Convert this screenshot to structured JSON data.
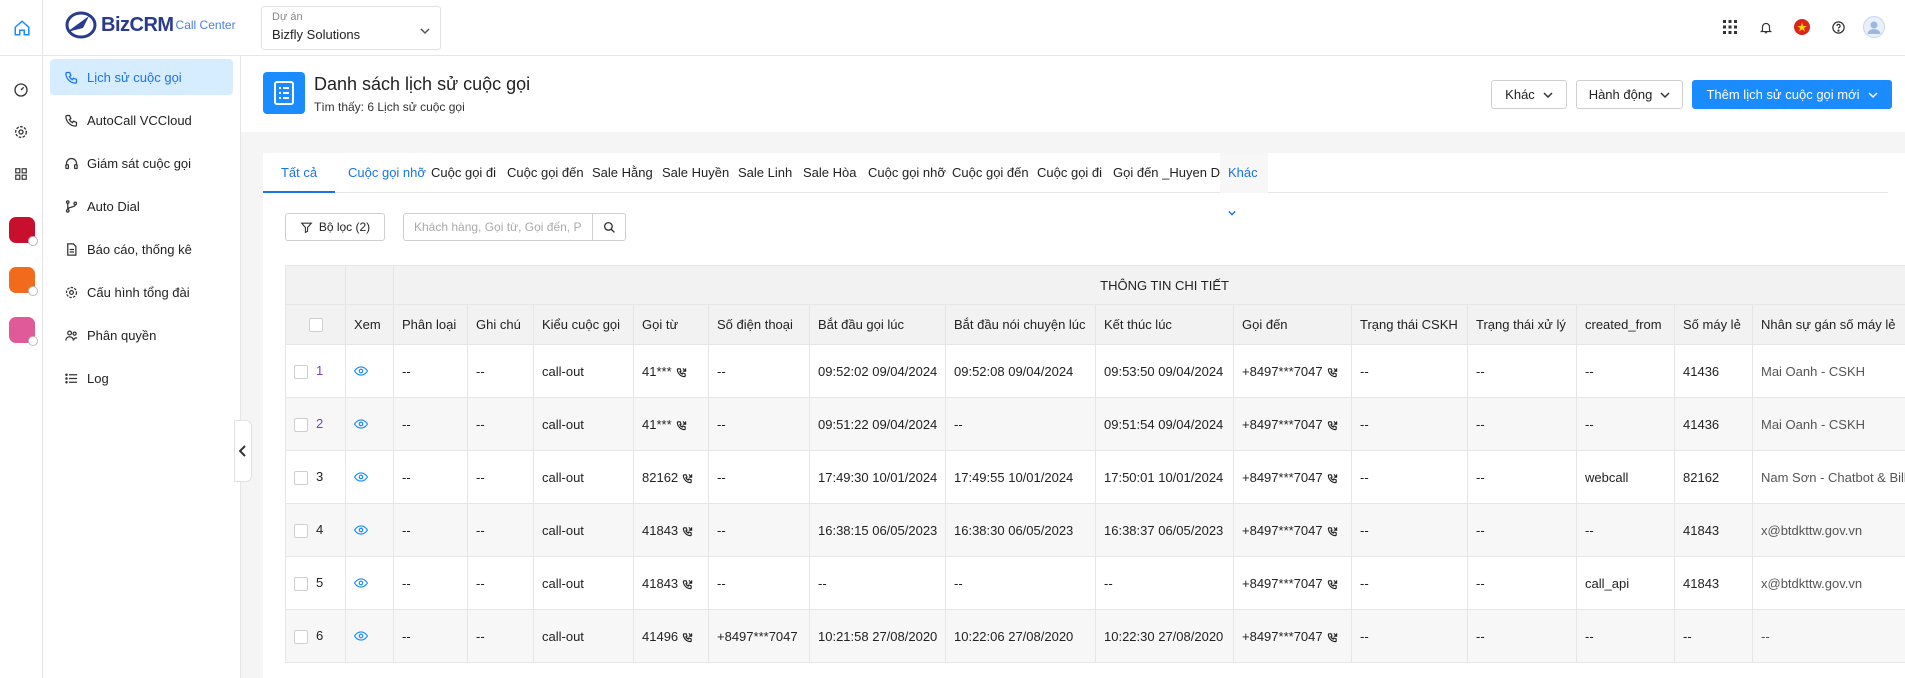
{
  "header": {
    "brand": "Biz",
    "brand_bold": "CRM",
    "brand_sub": "Call Center",
    "project_label": "Dự án",
    "project_value": "Bizfly Solutions"
  },
  "sidebar": {
    "items": [
      {
        "label": "Lịch sử cuộc gọi",
        "icon": "phone-history-icon"
      },
      {
        "label": "AutoCall VCCloud",
        "icon": "autocall-icon"
      },
      {
        "label": "Giám sát cuộc gọi",
        "icon": "headset-icon"
      },
      {
        "label": "Auto Dial",
        "icon": "branch-icon"
      },
      {
        "label": "Báo cáo, thống kê",
        "icon": "report-icon"
      },
      {
        "label": "Cấu hình tổng đài",
        "icon": "gear-icon"
      },
      {
        "label": "Phân quyền",
        "icon": "users-icon"
      },
      {
        "label": "Log",
        "icon": "list-icon"
      }
    ]
  },
  "page": {
    "title": "Danh sách lịch sử cuộc gọi",
    "subtitle": "Tìm thấy: 6 Lịch sử cuộc gọi",
    "btn_other": "Khác",
    "btn_action": "Hành động",
    "btn_add": "Thêm lịch sử cuộc gọi mới"
  },
  "tabs": [
    "Tất cả",
    "Cuộc gọi nhỡ",
    "Cuộc gọi đi",
    "Cuộc gọi đến",
    "Sale Hằng",
    "Sale Huyền",
    "Sale Linh",
    "Sale Hòa",
    "Cuộc gọi nhỡ",
    "Cuộc gọi đến",
    "Cuộc gọi đi",
    "Gọi đến _Huyen Du",
    "Khác"
  ],
  "filter": {
    "label": "Bộ lọc (2)",
    "placeholder": "Khách hàng, Gọi từ, Gọi đến, Phòng"
  },
  "table": {
    "group_header": "THÔNG TIN CHI TIẾT",
    "columns": [
      "Xem",
      "Phân loại",
      "Ghi chú",
      "Kiểu cuộc gọi",
      "Gọi từ",
      "Số điện thoại",
      "Bắt đầu gọi lúc",
      "Bắt đầu nói chuyện lúc",
      "Kết thúc lúc",
      "Gọi đến",
      "Trạng thái CSKH",
      "Trạng thái xử lý",
      "created_from",
      "Số máy lẻ",
      "Nhân sự gán số máy lẻ"
    ],
    "rows": [
      {
        "idx": "1",
        "phan_loai": "--",
        "ghi_chu": "--",
        "kieu": "call-out",
        "goi_tu": "41***",
        "sdt": "--",
        "bat_dau": "09:52:02 09/04/2024",
        "noi_chuyen": "09:52:08 09/04/2024",
        "ket_thuc": "09:53:50 09/04/2024",
        "goi_den": "+8497***7047",
        "cskh": "--",
        "xu_ly": "--",
        "created_from": "--",
        "may_le": "41436",
        "nhan_su": "Mai Oanh - CSKH"
      },
      {
        "idx": "2",
        "phan_loai": "--",
        "ghi_chu": "--",
        "kieu": "call-out",
        "goi_tu": "41***",
        "sdt": "--",
        "bat_dau": "09:51:22 09/04/2024",
        "noi_chuyen": "--",
        "ket_thuc": "09:51:54 09/04/2024",
        "goi_den": "+8497***7047",
        "cskh": "--",
        "xu_ly": "--",
        "created_from": "--",
        "may_le": "41436",
        "nhan_su": "Mai Oanh - CSKH"
      },
      {
        "idx": "3",
        "phan_loai": "--",
        "ghi_chu": "--",
        "kieu": "call-out",
        "goi_tu": "82162",
        "sdt": "--",
        "bat_dau": "17:49:30 10/01/2024",
        "noi_chuyen": "17:49:55 10/01/2024",
        "ket_thuc": "17:50:01 10/01/2024",
        "goi_den": "+8497***7047",
        "cskh": "--",
        "xu_ly": "--",
        "created_from": "webcall",
        "may_le": "82162",
        "nhan_su": "Nam Sơn - Chatbot & Billin"
      },
      {
        "idx": "4",
        "phan_loai": "--",
        "ghi_chu": "--",
        "kieu": "call-out",
        "goi_tu": "41843",
        "sdt": "--",
        "bat_dau": "16:38:15 06/05/2023",
        "noi_chuyen": "16:38:30 06/05/2023",
        "ket_thuc": "16:38:37 06/05/2023",
        "goi_den": "+8497***7047",
        "cskh": "--",
        "xu_ly": "--",
        "created_from": "--",
        "may_le": "41843",
        "nhan_su": "x@btdkttw.gov.vn"
      },
      {
        "idx": "5",
        "phan_loai": "--",
        "ghi_chu": "--",
        "kieu": "call-out",
        "goi_tu": "41843",
        "sdt": "--",
        "bat_dau": "--",
        "noi_chuyen": "--",
        "ket_thuc": "--",
        "goi_den": "+8497***7047",
        "cskh": "--",
        "xu_ly": "--",
        "created_from": "call_api",
        "may_le": "41843",
        "nhan_su": "x@btdkttw.gov.vn"
      },
      {
        "idx": "6",
        "phan_loai": "--",
        "ghi_chu": "--",
        "kieu": "call-out",
        "goi_tu": "41496",
        "sdt": "+8497***7047",
        "bat_dau": "10:21:58 27/08/2020",
        "noi_chuyen": "10:22:06 27/08/2020",
        "ket_thuc": "10:22:30 27/08/2020",
        "goi_den": "+8497***7047",
        "cskh": "--",
        "xu_ly": "--",
        "created_from": "--",
        "may_le": "--",
        "nhan_su": "--"
      }
    ]
  },
  "colors": {
    "accent": "#1a8cff",
    "active_bg": "#d6ecff",
    "link": "#1a73e8"
  }
}
